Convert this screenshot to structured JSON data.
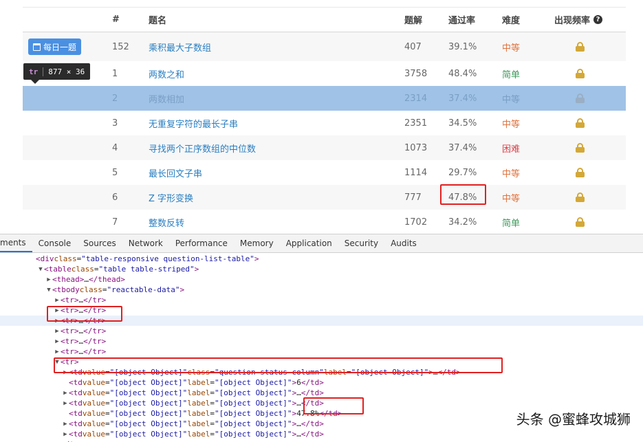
{
  "table": {
    "headers": {
      "num": "#",
      "title": "题名",
      "solutions": "题解",
      "rate": "通过率",
      "difficulty": "难度",
      "frequency": "出现频率"
    },
    "daily_label": "每日一题",
    "rows": [
      {
        "num": "152",
        "title": "乘积最大子数组",
        "solutions": "407",
        "rate": "39.1%",
        "difficulty": "中等",
        "level": "medium"
      },
      {
        "num": "1",
        "title": "两数之和",
        "solutions": "3758",
        "rate": "48.4%",
        "difficulty": "简单",
        "level": "easy"
      },
      {
        "num": "2",
        "title": "两数相加",
        "solutions": "2314",
        "rate": "37.4%",
        "difficulty": "中等",
        "level": "medium"
      },
      {
        "num": "3",
        "title": "无重复字符的最长子串",
        "solutions": "2351",
        "rate": "34.5%",
        "difficulty": "中等",
        "level": "medium"
      },
      {
        "num": "4",
        "title": "寻找两个正序数组的中位数",
        "solutions": "1073",
        "rate": "37.4%",
        "difficulty": "困难",
        "level": "hard"
      },
      {
        "num": "5",
        "title": "最长回文子串",
        "solutions": "1114",
        "rate": "29.7%",
        "difficulty": "中等",
        "level": "medium"
      },
      {
        "num": "6",
        "title": "Z 字形变换",
        "solutions": "777",
        "rate": "47.8%",
        "difficulty": "中等",
        "level": "medium"
      },
      {
        "num": "7",
        "title": "整数反转",
        "solutions": "1702",
        "rate": "34.2%",
        "difficulty": "简单",
        "level": "easy"
      }
    ]
  },
  "tooltip": {
    "tag": "tr",
    "size": "877 × 36"
  },
  "devtools": {
    "tabs": [
      "ments",
      "Console",
      "Sources",
      "Network",
      "Performance",
      "Memory",
      "Application",
      "Security",
      "Audits"
    ],
    "lines": [
      {
        "indent": 0,
        "tri": "",
        "segs": [
          [
            "x",
            "  "
          ],
          [
            "t",
            "<div "
          ],
          [
            "a",
            "class"
          ],
          [
            "x",
            "="
          ],
          [
            "v",
            "\"table-responsive question-list-table\""
          ],
          [
            "t",
            ">"
          ]
        ]
      },
      {
        "indent": 1,
        "tri": "▼",
        "segs": [
          [
            "t",
            "<table "
          ],
          [
            "a",
            "class"
          ],
          [
            "x",
            "="
          ],
          [
            "v",
            "\"table table-striped\""
          ],
          [
            "t",
            ">"
          ]
        ]
      },
      {
        "indent": 2,
        "tri": "▶",
        "segs": [
          [
            "t",
            "<thead>"
          ],
          [
            "x",
            "…"
          ],
          [
            "t",
            "</thead>"
          ]
        ]
      },
      {
        "indent": 2,
        "tri": "▼",
        "segs": [
          [
            "t",
            "<tbody "
          ],
          [
            "a",
            "class"
          ],
          [
            "x",
            "="
          ],
          [
            "v",
            "\"reactable-data\""
          ],
          [
            "t",
            ">"
          ]
        ]
      },
      {
        "indent": 3,
        "tri": "▶",
        "segs": [
          [
            "t",
            "<tr>"
          ],
          [
            "x",
            "…"
          ],
          [
            "t",
            "</tr>"
          ]
        ]
      },
      {
        "indent": 3,
        "tri": "▶",
        "segs": [
          [
            "t",
            "<tr>"
          ],
          [
            "x",
            "…"
          ],
          [
            "t",
            "</tr>"
          ]
        ]
      },
      {
        "indent": 3,
        "tri": "▶",
        "segs": [
          [
            "t",
            "<tr>"
          ],
          [
            "x",
            "…"
          ],
          [
            "t",
            "</tr>"
          ]
        ],
        "hl": true
      },
      {
        "indent": 3,
        "tri": "▶",
        "segs": [
          [
            "t",
            "<tr>"
          ],
          [
            "x",
            "…"
          ],
          [
            "t",
            "</tr>"
          ]
        ]
      },
      {
        "indent": 3,
        "tri": "▶",
        "segs": [
          [
            "t",
            "<tr>"
          ],
          [
            "x",
            "…"
          ],
          [
            "t",
            "</tr>"
          ]
        ]
      },
      {
        "indent": 3,
        "tri": "▶",
        "segs": [
          [
            "t",
            "<tr>"
          ],
          [
            "x",
            "…"
          ],
          [
            "t",
            "</tr>"
          ]
        ]
      },
      {
        "indent": 3,
        "tri": "▼",
        "segs": [
          [
            "t",
            "<tr>"
          ]
        ]
      },
      {
        "indent": 4,
        "tri": "▶",
        "segs": [
          [
            "t",
            "<td "
          ],
          [
            "a",
            "value"
          ],
          [
            "x",
            "="
          ],
          [
            "v",
            "\"[object Object]\" "
          ],
          [
            "a",
            "class"
          ],
          [
            "x",
            "="
          ],
          [
            "v",
            "\"question-status-column\" "
          ],
          [
            "a",
            "label"
          ],
          [
            "x",
            "="
          ],
          [
            "v",
            "\"[object Object]\""
          ],
          [
            "t",
            ">"
          ],
          [
            "x",
            "…"
          ],
          [
            "t",
            "</td>"
          ]
        ]
      },
      {
        "indent": 4,
        "tri": "",
        "segs": [
          [
            "t",
            "<td "
          ],
          [
            "a",
            "value"
          ],
          [
            "x",
            "="
          ],
          [
            "v",
            "\"[object Object]\" "
          ],
          [
            "a",
            "label"
          ],
          [
            "x",
            "="
          ],
          [
            "v",
            "\"[object Object]\""
          ],
          [
            "t",
            ">"
          ],
          [
            "x",
            "6"
          ],
          [
            "t",
            "</td>"
          ]
        ]
      },
      {
        "indent": 4,
        "tri": "▶",
        "segs": [
          [
            "t",
            "<td "
          ],
          [
            "a",
            "value"
          ],
          [
            "x",
            "="
          ],
          [
            "v",
            "\"[object Object]\" "
          ],
          [
            "a",
            "label"
          ],
          [
            "x",
            "="
          ],
          [
            "v",
            "\"[object Object]\""
          ],
          [
            "t",
            ">"
          ],
          [
            "x",
            "…"
          ],
          [
            "t",
            "</td>"
          ]
        ]
      },
      {
        "indent": 4,
        "tri": "▶",
        "segs": [
          [
            "t",
            "<td "
          ],
          [
            "a",
            "value"
          ],
          [
            "x",
            "="
          ],
          [
            "v",
            "\"[object Object]\" "
          ],
          [
            "a",
            "label"
          ],
          [
            "x",
            "="
          ],
          [
            "v",
            "\"[object Object]\""
          ],
          [
            "t",
            ">"
          ],
          [
            "x",
            "…"
          ],
          [
            "t",
            "</td>"
          ]
        ]
      },
      {
        "indent": 4,
        "tri": "",
        "segs": [
          [
            "t",
            "<td "
          ],
          [
            "a",
            "value"
          ],
          [
            "x",
            "="
          ],
          [
            "v",
            "\"[object Object]\" "
          ],
          [
            "a",
            "label"
          ],
          [
            "x",
            "="
          ],
          [
            "v",
            "\"[object Object]\""
          ],
          [
            "t",
            ">"
          ],
          [
            "x",
            "47.8%"
          ],
          [
            "t",
            "</td>"
          ]
        ]
      },
      {
        "indent": 4,
        "tri": "▶",
        "segs": [
          [
            "t",
            "<td "
          ],
          [
            "a",
            "value"
          ],
          [
            "x",
            "="
          ],
          [
            "v",
            "\"[object Object]\" "
          ],
          [
            "a",
            "label"
          ],
          [
            "x",
            "="
          ],
          [
            "v",
            "\"[object Object]\""
          ],
          [
            "t",
            ">"
          ],
          [
            "x",
            "…"
          ],
          [
            "t",
            "</td>"
          ]
        ]
      },
      {
        "indent": 4,
        "tri": "▶",
        "segs": [
          [
            "t",
            "<td "
          ],
          [
            "a",
            "value"
          ],
          [
            "x",
            "="
          ],
          [
            "v",
            "\"[object Object]\" "
          ],
          [
            "a",
            "label"
          ],
          [
            "x",
            "="
          ],
          [
            "v",
            "\"[object Object]\""
          ],
          [
            "t",
            ">"
          ],
          [
            "x",
            "…"
          ],
          [
            "t",
            "</td>"
          ]
        ]
      },
      {
        "indent": 3,
        "tri": "",
        "segs": [
          [
            "t",
            "</tr>"
          ]
        ]
      }
    ]
  },
  "watermark": "头条 @蜜蜂攻城狮",
  "colors": {
    "link": "#2a7fc1",
    "easy": "#3c9a5a",
    "medium": "#e0733e",
    "hard": "#d9434b",
    "selected_row": "#9fc2e6",
    "daily_button": "#4a90e2",
    "highlight_box": "#e02020"
  }
}
